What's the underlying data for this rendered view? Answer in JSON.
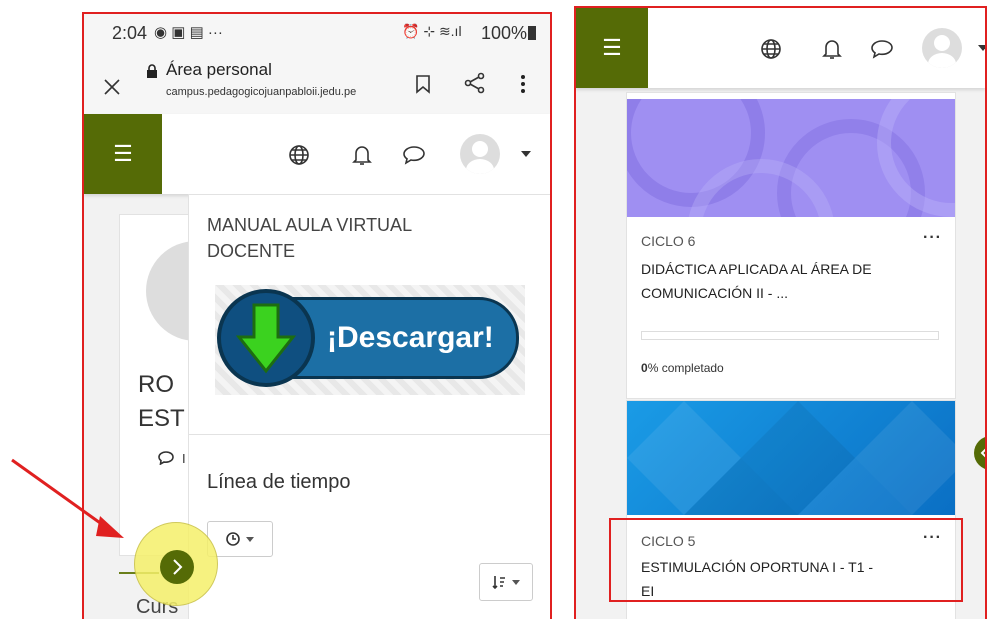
{
  "left_phone": {
    "status": {
      "time": "2:04",
      "battery": "100%"
    },
    "browser": {
      "title": "Área personal",
      "url": "campus.pedagogicojuanpabloii.jedu.pe"
    },
    "profile": {
      "name_line1": "RO",
      "name_line2": "EST",
      "msg_fragment": "I"
    },
    "manual": {
      "title_line1": "MANUAL AULA VIRTUAL",
      "title_line2": "DOCENTE",
      "download_label": "¡Descargar!"
    },
    "timeline": {
      "title": "Línea de tiempo"
    },
    "courses_fragment": "Curs"
  },
  "right_phone": {
    "course1": {
      "cycle": "CICLO 6",
      "name_line1": "DIDÁCTICA APLICADA AL ÁREA DE",
      "name_line2": "COMUNICACIÓN II - ...",
      "progress_pct": "0",
      "progress_suffix": "% completado",
      "progress": 0
    },
    "course2": {
      "cycle": "CICLO 5",
      "name_line1": "ESTIMULACIÓN OPORTUNA I - T1 -",
      "name_line2": "EI"
    }
  },
  "colors": {
    "brand": "#556b06",
    "highlight": "#e02020",
    "marker": "#f5f06a"
  },
  "icons": [
    "close-icon",
    "lock-icon",
    "bookmark-icon",
    "share-icon",
    "more-icon",
    "menu-icon",
    "globe-icon",
    "bell-icon",
    "chat-icon",
    "avatar-icon",
    "caret-down-icon",
    "clock-icon",
    "sort-icon",
    "chevron-right-icon",
    "chevron-left-icon",
    "arrow-annotation"
  ]
}
